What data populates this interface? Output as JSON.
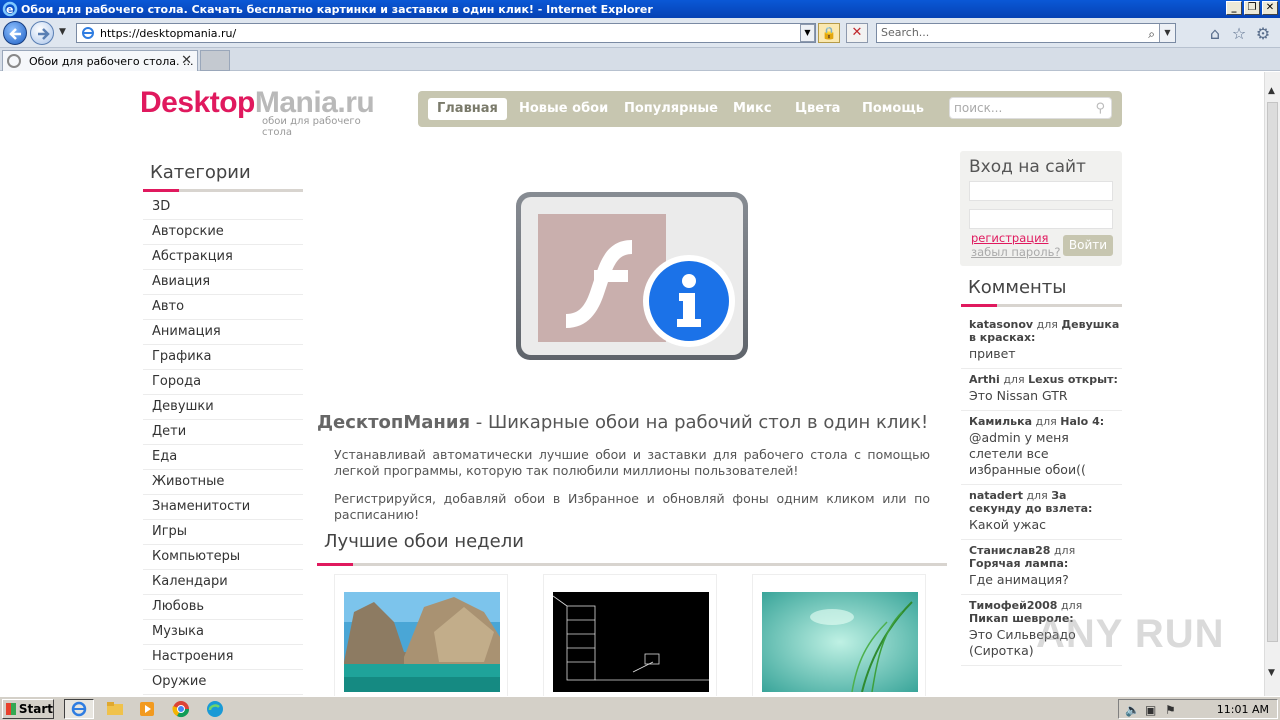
{
  "window": {
    "title": "Обои для рабочего стола. Скачать бесплатно картинки и заставки в один клик! - Internet Explorer",
    "buttons": {
      "minimize": "_",
      "restore": "❐",
      "close": "✕"
    }
  },
  "browser": {
    "address": "https://desktopmania.ru/",
    "search_placeholder": "Search...",
    "tab_label": "Обои для рабочего стола. ...",
    "tab_close": "✕"
  },
  "site": {
    "logo_desktop": "Desktop",
    "logo_mania": "Mania",
    "logo_tld": ".ru",
    "tagline": "обои для рабочего стола",
    "nav": [
      "Главная",
      "Новые обои",
      "Популярные",
      "Микс",
      "Цвета",
      "Помощь"
    ],
    "search_placeholder": "поиск..."
  },
  "categories": {
    "title": "Категории",
    "items": [
      "3D",
      "Авторские",
      "Абстракция",
      "Авиация",
      "Авто",
      "Анимация",
      "Графика",
      "Города",
      "Девушки",
      "Дети",
      "Еда",
      "Животные",
      "Знаменитости",
      "Игры",
      "Компьютеры",
      "Календари",
      "Любовь",
      "Музыка",
      "Настроения",
      "Оружие"
    ]
  },
  "intro": {
    "brand": "ДесктопМания",
    "heading_rest": " - Шикарные обои на рабочий стол в один клик!",
    "p1": "Устанавливай автоматически лучшие обои и заставки для рабочего стола с помощью легкой программы, которую так полюбили миллионы пользователей!",
    "p2": "Регистрируйся, добавляй обои в Избранное и обновляй фоны одним кликом или по расписанию!"
  },
  "best": {
    "title": "Лучшие обои недели"
  },
  "login": {
    "title": "Вход на сайт",
    "register": "регистрация",
    "forgot": "забыл пароль?",
    "submit": "Войти"
  },
  "comments": {
    "title": "Комменты",
    "connector": "для",
    "items": [
      {
        "user": "katasonov",
        "target": "Девушка в красках:",
        "text": "привет"
      },
      {
        "user": "Arthi",
        "target": "Lexus открыт:",
        "text": "Это Nissan GTR"
      },
      {
        "user": "Камилька",
        "target": "Halo 4:",
        "text": "@admin у меня слетели все избранные обои(("
      },
      {
        "user": "natadert",
        "target": "За секунду до взлета:",
        "text": "Какой ужас"
      },
      {
        "user": "Станислав28",
        "target": "Горячая лампа:",
        "text": "Где анимация?"
      },
      {
        "user": "Тимофей2008",
        "target": "Пикап шевроле:",
        "text": "Это Сильверадо (Сиротка)"
      }
    ]
  },
  "watermark": "ANY RUN",
  "taskbar": {
    "start": "Start",
    "clock": "11:01 AM"
  }
}
